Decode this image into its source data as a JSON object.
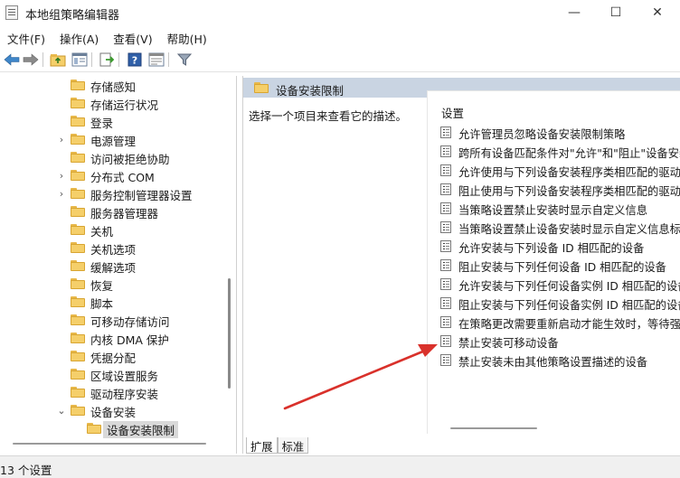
{
  "window": {
    "title": "本地组策略编辑器",
    "minimize": "—",
    "maximize": "☐",
    "close": "✕"
  },
  "menu": [
    "文件(F)",
    "操作(A)",
    "查看(V)",
    "帮助(H)"
  ],
  "toolbar": {
    "icons": [
      "back-arrow-icon",
      "forward-arrow-icon",
      "up-folder-icon",
      "show-hide-tree-icon",
      "export-list-icon",
      "help-icon",
      "properties-icon",
      "filter-icon"
    ]
  },
  "tree": {
    "items": [
      {
        "label": "存储感知",
        "expander": ""
      },
      {
        "label": "存储运行状况",
        "expander": ""
      },
      {
        "label": "登录",
        "expander": ""
      },
      {
        "label": "电源管理",
        "expander": "›"
      },
      {
        "label": "访问被拒绝协助",
        "expander": ""
      },
      {
        "label": "分布式 COM",
        "expander": "›"
      },
      {
        "label": "服务控制管理器设置",
        "expander": "›"
      },
      {
        "label": "服务器管理器",
        "expander": ""
      },
      {
        "label": "关机",
        "expander": ""
      },
      {
        "label": "关机选项",
        "expander": ""
      },
      {
        "label": "缓解选项",
        "expander": ""
      },
      {
        "label": "恢复",
        "expander": ""
      },
      {
        "label": "脚本",
        "expander": ""
      },
      {
        "label": "可移动存储访问",
        "expander": ""
      },
      {
        "label": "内核 DMA 保护",
        "expander": ""
      },
      {
        "label": "凭据分配",
        "expander": ""
      },
      {
        "label": "区域设置服务",
        "expander": ""
      },
      {
        "label": "驱动程序安装",
        "expander": ""
      },
      {
        "label": "设备安装",
        "expander": "⌄"
      },
      {
        "label": "设备安装限制",
        "expander": ""
      }
    ],
    "selected": "设备安装限制"
  },
  "right": {
    "header_title": "设备安装限制",
    "description": "选择一个项目来查看它的描述。",
    "list_header": "设置",
    "policies": [
      "允许管理员忽略设备安装限制策略",
      "跨所有设备匹配条件对\"允许\"和\"阻止\"设备安装",
      "允许使用与下列设备安装程序类相匹配的驱动程",
      "阻止使用与下列设备安装程序类相匹配的驱动程",
      "当策略设置禁止安装时显示自定义信息",
      "当策略设置禁止设备安装时显示自定义信息标题",
      "允许安装与下列设备 ID 相匹配的设备",
      "阻止安装与下列任何设备 ID 相匹配的设备",
      "允许安装与下列任何设备实例 ID 相匹配的设备",
      "阻止安装与下列任何设备实例 ID 相匹配的设备",
      "在策略更改需要重新启动才能生效时，等待强制",
      "禁止安装可移动设备",
      "禁止安装未由其他策略设置描述的设备"
    ]
  },
  "tabs": [
    "扩展",
    "标准"
  ],
  "active_tab": "扩展",
  "status": "13 个设置",
  "colors": {
    "header_bg": "#c9d4e2",
    "arrow": "#d9312b",
    "folder": "#f5cf6a",
    "selection": "#d9d9d9"
  }
}
